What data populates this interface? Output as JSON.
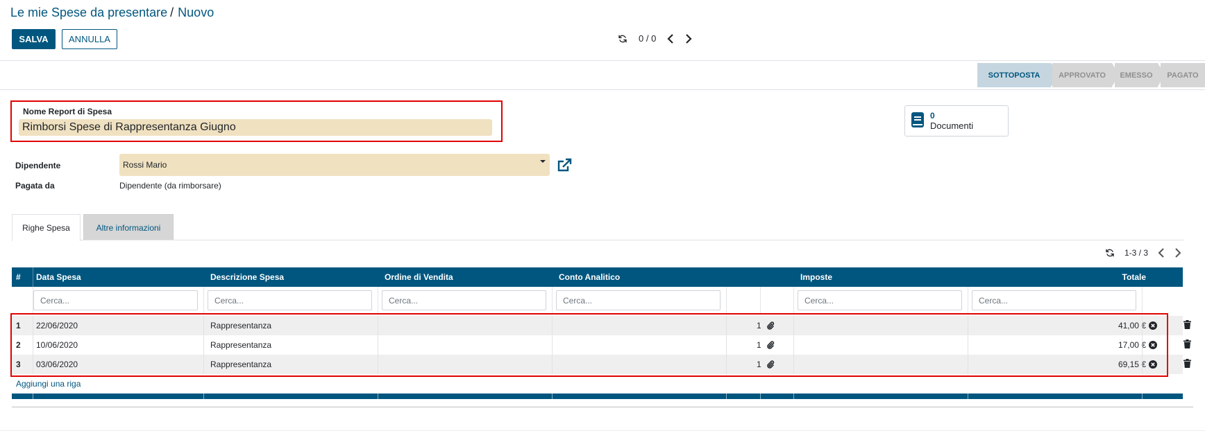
{
  "breadcrumb": {
    "parent": "Le mie Spese da presentare",
    "separator": "/",
    "current": "Nuovo"
  },
  "toolbar": {
    "save_label": "SALVA",
    "discard_label": "ANNULLA"
  },
  "pager": {
    "counter": "0 / 0"
  },
  "statusbar": {
    "stages": [
      "SOTTOPOSTA",
      "APPROVATO",
      "EMESSO",
      "PAGATO"
    ],
    "active": "SOTTOPOSTA"
  },
  "title": {
    "label": "Nome Report di Spesa",
    "value": "Rimborsi Spese di Rappresentanza Giugno"
  },
  "smart_button": {
    "count": "0",
    "label": "Documenti"
  },
  "fields": {
    "employee": {
      "label": "Dipendente",
      "value": "Rossi Mario"
    },
    "paid_by": {
      "label": "Pagata da",
      "value": "Dipendente (da rimborsare)"
    }
  },
  "tabs": [
    {
      "label": "Righe Spesa",
      "active": true
    },
    {
      "label": "Altre informazioni",
      "active": false
    }
  ],
  "list": {
    "pager": "1-3 / 3",
    "columns": [
      "#",
      "Data Spesa",
      "Descrizione Spesa",
      "Ordine di Vendita",
      "Conto Analitico",
      "Imposte",
      "Totale"
    ],
    "filter_placeholder": "Cerca...",
    "rows": [
      {
        "num": "1",
        "date": "22/06/2020",
        "desc": "Rappresentanza",
        "qty": "1",
        "total": "41,00 €"
      },
      {
        "num": "2",
        "date": "10/06/2020",
        "desc": "Rappresentanza",
        "qty": "1",
        "total": "17,00 €"
      },
      {
        "num": "3",
        "date": "03/06/2020",
        "desc": "Rappresentanza",
        "qty": "1",
        "total": "69,15 €"
      }
    ],
    "add_line": "Aggiungi una riga"
  },
  "colors": {
    "brand": "#00567f",
    "required_field": "#f0e1c1",
    "highlight": "#e00000"
  },
  "icons": [
    "refresh-icon",
    "chevron-left-icon",
    "chevron-right-icon",
    "book-icon",
    "external-link-icon",
    "paperclip-icon",
    "remove-circle-icon",
    "trash-icon"
  ]
}
